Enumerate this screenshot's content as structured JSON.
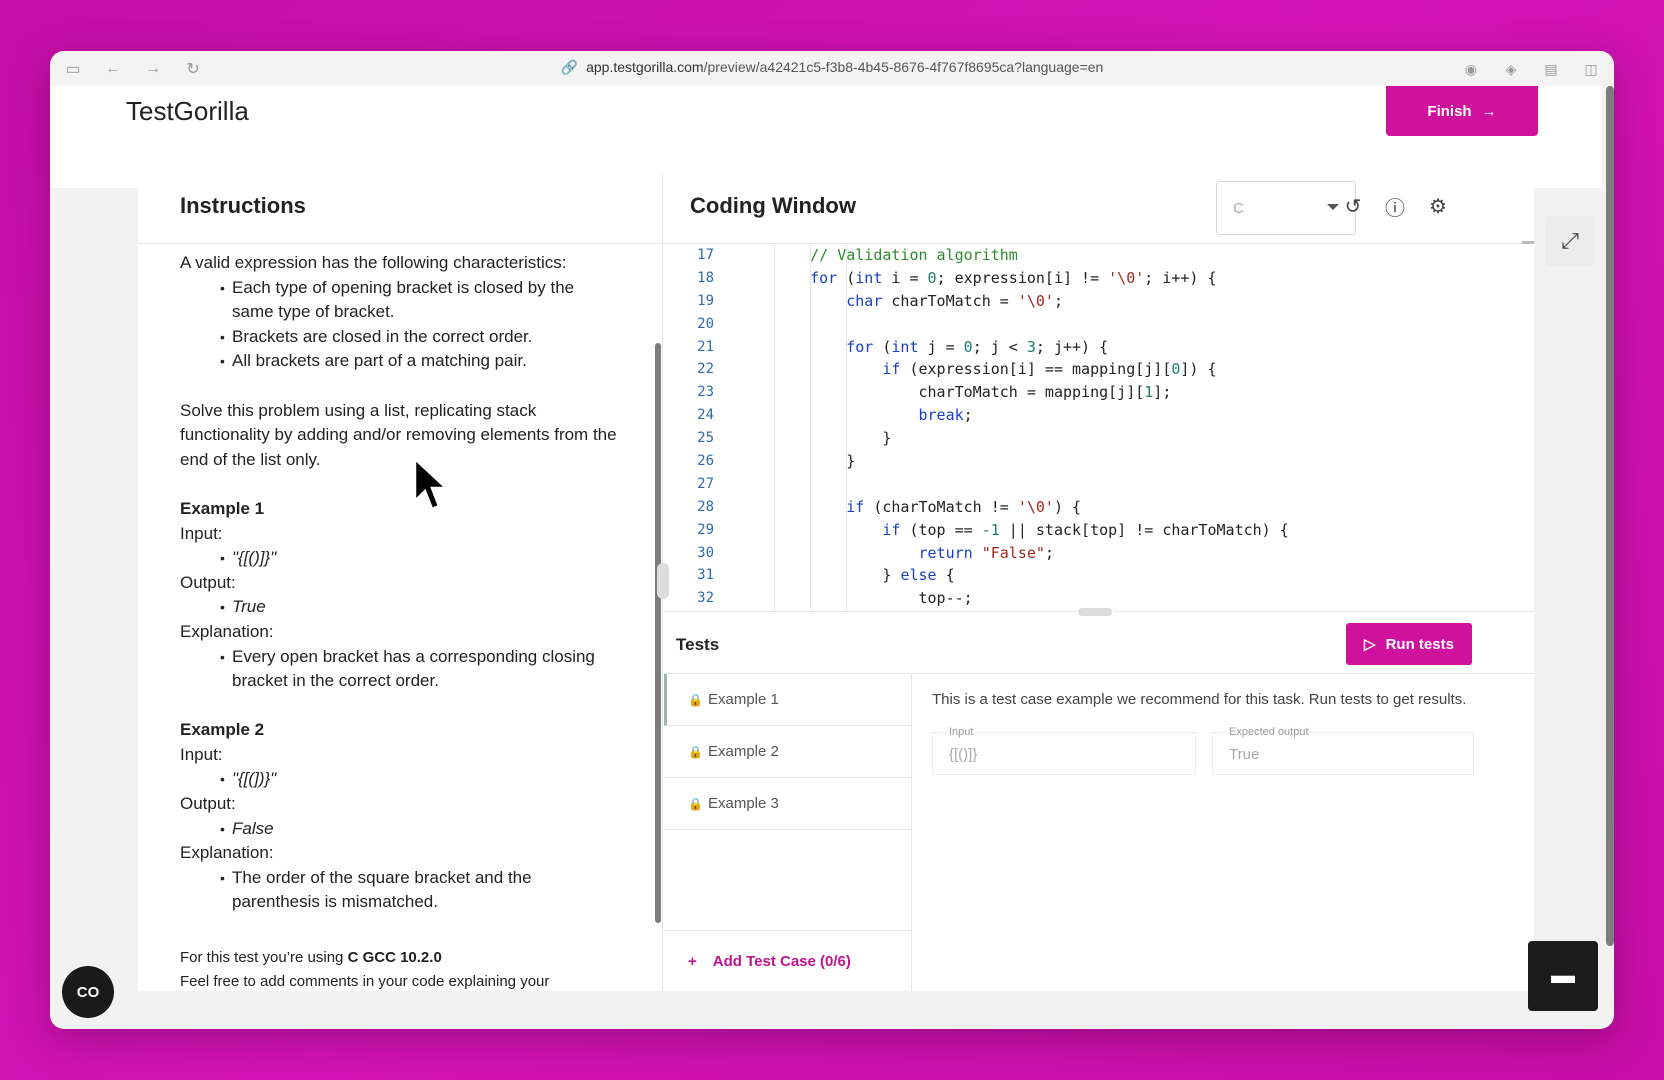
{
  "browser": {
    "url_host": "app.testgorilla.com",
    "url_path": "/preview/a42421c5-f3b8-4b45-8676-4f767f8695ca?language=en",
    "nav_icons": [
      "sidebar-icon",
      "back-icon",
      "forward-icon",
      "reload-icon"
    ],
    "extension_icons": [
      "grammarly-icon",
      "extension-icon",
      "reader-icon",
      "split-view-icon"
    ]
  },
  "app": {
    "brand": "TestGorilla",
    "finish_label": "Finish",
    "accent_color": "#d0119e"
  },
  "instructions": {
    "title": "Instructions",
    "intro": "A valid expression has the following characteristics:",
    "rules": [
      "Each type of opening bracket is closed by the same type of bracket.",
      "Brackets are closed in the correct order.",
      "All brackets are part of a matching pair."
    ],
    "solve_text": "Solve this problem using a list, replicating stack functionality by adding and/or removing elements from the end of the list only.",
    "example1": {
      "title": "Example 1",
      "input_label": "Input:",
      "input": "\"{[()]}\"",
      "output_label": "Output:",
      "output": "True",
      "explanation_label": "Explanation:",
      "explanation": "Every open bracket has a corresponding closing bracket in the correct order."
    },
    "example2": {
      "title": "Example 2",
      "input_label": "Input:",
      "input": "\"{[(])}\"",
      "output_label": "Output:",
      "output": "False",
      "explanation_label": "Explanation:",
      "explanation": "The order of the square bracket and the parenthesis is mismatched."
    },
    "footer_prefix": "For this test you’re using ",
    "footer_lang": "C GCC 10.2.0",
    "footer_cut": "Feel free to add comments in your code explaining your"
  },
  "coding": {
    "title": "Coding Window",
    "language": "C",
    "tool_icons": [
      "reset-icon",
      "help-icon",
      "settings-icon"
    ]
  },
  "tests": {
    "title": "Tests",
    "run_label": "Run tests",
    "items": [
      "Example 1",
      "Example 2",
      "Example 3"
    ],
    "add_label": "Add Test Case (0/6)",
    "note": "This is a test case example we recommend for this task. Run tests to get results.",
    "input_label": "Input",
    "input_value": "{[()]}",
    "expected_label": "Expected output",
    "expected_value": "True"
  },
  "widgets": {
    "cc_label": "CO"
  }
}
